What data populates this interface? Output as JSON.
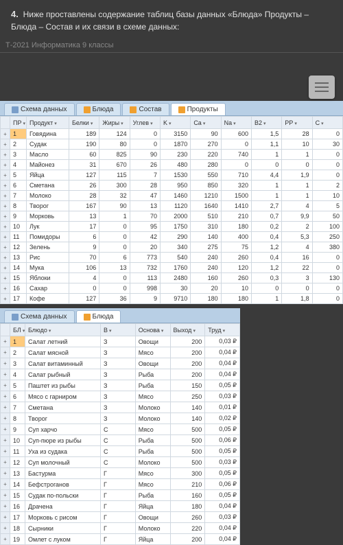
{
  "question": {
    "number": "4.",
    "text": "Ниже проставлены содержание таблиц базы данных «Блюда» Продукты – Блюда – Состав и их связи в схеме данных:"
  },
  "meta": "Т-2021   Информатика  9 классы",
  "window1": {
    "tabs": [
      {
        "label": "Схема данных",
        "icon": "schema",
        "active": false
      },
      {
        "label": "Блюда",
        "icon": "table",
        "active": false
      },
      {
        "label": "Состав",
        "icon": "table",
        "active": false
      },
      {
        "label": "Продукты",
        "icon": "table",
        "active": true
      }
    ],
    "headers": [
      "",
      "ПР",
      "Продукт",
      "Белки",
      "Жиры",
      "Углев",
      "K",
      "Ca",
      "Na",
      "B2",
      "PP",
      "C"
    ],
    "rows": [
      [
        "1",
        "Говядина",
        "189",
        "124",
        "0",
        "3150",
        "90",
        "600",
        "1,5",
        "28",
        "0"
      ],
      [
        "2",
        "Судак",
        "190",
        "80",
        "0",
        "1870",
        "270",
        "0",
        "1,1",
        "10",
        "30"
      ],
      [
        "3",
        "Масло",
        "60",
        "825",
        "90",
        "230",
        "220",
        "740",
        "1",
        "1",
        "0"
      ],
      [
        "4",
        "Майонез",
        "31",
        "670",
        "26",
        "480",
        "280",
        "0",
        "0",
        "0",
        "0"
      ],
      [
        "5",
        "Яйца",
        "127",
        "115",
        "7",
        "1530",
        "550",
        "710",
        "4,4",
        "1,9",
        "0"
      ],
      [
        "6",
        "Сметана",
        "26",
        "300",
        "28",
        "950",
        "850",
        "320",
        "1",
        "1",
        "2"
      ],
      [
        "7",
        "Молоко",
        "28",
        "32",
        "47",
        "1460",
        "1210",
        "1500",
        "1",
        "1",
        "10"
      ],
      [
        "8",
        "Творог",
        "167",
        "90",
        "13",
        "1120",
        "1640",
        "1410",
        "2,7",
        "4",
        "5"
      ],
      [
        "9",
        "Морковь",
        "13",
        "1",
        "70",
        "2000",
        "510",
        "210",
        "0,7",
        "9,9",
        "50"
      ],
      [
        "10",
        "Лук",
        "17",
        "0",
        "95",
        "1750",
        "310",
        "180",
        "0,2",
        "2",
        "100"
      ],
      [
        "11",
        "Помидоры",
        "6",
        "0",
        "42",
        "290",
        "140",
        "400",
        "0,4",
        "5,3",
        "250"
      ],
      [
        "12",
        "Зелень",
        "9",
        "0",
        "20",
        "340",
        "275",
        "75",
        "1,2",
        "4",
        "380"
      ],
      [
        "13",
        "Рис",
        "70",
        "6",
        "773",
        "540",
        "240",
        "260",
        "0,4",
        "16",
        "0"
      ],
      [
        "14",
        "Мука",
        "106",
        "13",
        "732",
        "1760",
        "240",
        "120",
        "1,2",
        "22",
        "0"
      ],
      [
        "15",
        "Яблоки",
        "4",
        "0",
        "113",
        "2480",
        "160",
        "260",
        "0,3",
        "3",
        "130"
      ],
      [
        "16",
        "Сахар",
        "0",
        "0",
        "998",
        "30",
        "20",
        "10",
        "0",
        "0",
        "0"
      ],
      [
        "17",
        "Кофе",
        "127",
        "36",
        "9",
        "9710",
        "180",
        "180",
        "1",
        "1,8",
        "0"
      ]
    ]
  },
  "window2": {
    "tabs": [
      {
        "label": "Схема данных",
        "icon": "schema",
        "active": false
      },
      {
        "label": "Блюда",
        "icon": "table",
        "active": true
      }
    ],
    "headers": [
      "",
      "БЛ",
      "Блюдо",
      "В",
      "Основа",
      "Выход",
      "Труд"
    ],
    "rows": [
      [
        "1",
        "Салат летний",
        "З",
        "Овощи",
        "200",
        "0,03 ₽"
      ],
      [
        "2",
        "Салат мясной",
        "З",
        "Мясо",
        "200",
        "0,04 ₽"
      ],
      [
        "3",
        "Салат витаминный",
        "З",
        "Овощи",
        "200",
        "0,04 ₽"
      ],
      [
        "4",
        "Салат рыбный",
        "З",
        "Рыба",
        "200",
        "0,04 ₽"
      ],
      [
        "5",
        "Паштет из рыбы",
        "З",
        "Рыба",
        "150",
        "0,05 ₽"
      ],
      [
        "6",
        "Мясо с гарниром",
        "З",
        "Мясо",
        "250",
        "0,03 ₽"
      ],
      [
        "7",
        "Сметана",
        "З",
        "Молоко",
        "140",
        "0,01 ₽"
      ],
      [
        "8",
        "Творог",
        "З",
        "Молоко",
        "140",
        "0,02 ₽"
      ],
      [
        "9",
        "Суп харчо",
        "С",
        "Мясо",
        "500",
        "0,05 ₽"
      ],
      [
        "10",
        "Суп-пюре из рыбы",
        "С",
        "Рыба",
        "500",
        "0,06 ₽"
      ],
      [
        "11",
        "Уха из судака",
        "С",
        "Рыба",
        "500",
        "0,05 ₽"
      ],
      [
        "12",
        "Суп молочный",
        "С",
        "Молоко",
        "500",
        "0,03 ₽"
      ],
      [
        "13",
        "Бастурма",
        "Г",
        "Мясо",
        "300",
        "0,05 ₽"
      ],
      [
        "14",
        "Бефстроганов",
        "Г",
        "Мясо",
        "210",
        "0,06 ₽"
      ],
      [
        "15",
        "Судак по-польски",
        "Г",
        "Рыба",
        "160",
        "0,05 ₽"
      ],
      [
        "16",
        "Драчена",
        "Г",
        "Яйца",
        "180",
        "0,04 ₽"
      ],
      [
        "17",
        "Морковь с рисом",
        "Г",
        "Овощи",
        "260",
        "0,03 ₽"
      ],
      [
        "18",
        "Сырники",
        "Г",
        "Молоко",
        "220",
        "0,04 ₽"
      ],
      [
        "19",
        "Омлет с луком",
        "Г",
        "Яйца",
        "200",
        "0,04 ₽"
      ]
    ]
  }
}
